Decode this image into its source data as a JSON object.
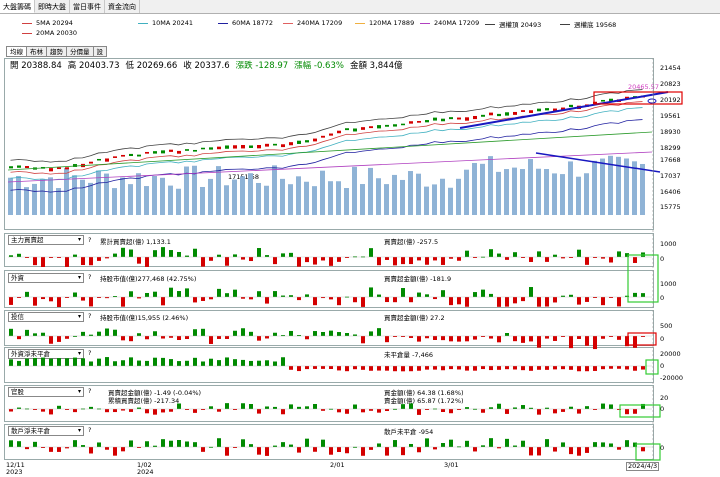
{
  "top_tabs": [
    "大盤籌碼",
    "即時大盤",
    "當日事件",
    "資金流向"
  ],
  "ma_legend": [
    {
      "label": "5MA 20294",
      "color": "#d04040"
    },
    {
      "label": "10MA 20241",
      "color": "#40b0c0"
    },
    {
      "label": "60MA 18772",
      "color": "#2020a0"
    },
    {
      "label": "240MA 17209",
      "color": "#e06060"
    },
    {
      "label": "120MA 17889",
      "color": "#f0b040"
    },
    {
      "label": "240MA 17209",
      "color": "#b040c0"
    },
    {
      "label": "週權頂 20493",
      "color": "#404040"
    },
    {
      "label": "週權底 19568",
      "color": "#404040"
    },
    {
      "label": "20MA 20030",
      "color": "#d04040"
    }
  ],
  "sub_tabs": [
    "均線",
    "布林",
    "趨勢",
    "分價量",
    "設"
  ],
  "quote": {
    "open": "開 20388.84",
    "high": "高 20403.73",
    "low": "低 20269.66",
    "close": "收 20337.6",
    "change": "漲跌 -128.97",
    "pct": "漲幅 -0.63%",
    "amount": "金額 3,844億"
  },
  "main_y_ticks": [
    "21454",
    "20823",
    "20192",
    "19561",
    "18930",
    "18299",
    "17668",
    "17037",
    "16406",
    "15775"
  ],
  "annotations": {
    "low_mark": "17151.58",
    "high_mark": "20465.57"
  },
  "panels": [
    {
      "select": "主力買賣超",
      "left": "累計買賣超(億) 1,133.1",
      "right": "買賣超(億) -257.5",
      "y": [
        "1000",
        "0"
      ]
    },
    {
      "select": "外資",
      "left": "持股市值(億)277,468 (42.75%)",
      "right": "買賣超金額(億) -181.9",
      "y": [
        "1000",
        "0"
      ]
    },
    {
      "select": "投信",
      "left": "持股市值(億)15,955 (2.46%)",
      "right": "買賣超金額(億) 27.2",
      "y": [
        "500",
        "0"
      ]
    },
    {
      "select": "外資淨未平倉",
      "left": "",
      "right": "未平倉量 -7,466",
      "y": [
        "20000",
        "0",
        "-20000"
      ]
    },
    {
      "select": "官股",
      "left": "買賣超金額(億) -1.49 (-0.04%)",
      "left2": "累積買賣超(億) -217.34",
      "right": "買金額(億) 64.38 (1.68%)",
      "right2": "賣金額(億) 65.87 (1.72%)",
      "y": [
        "20",
        "0"
      ]
    },
    {
      "select": "散戶淨未平倉",
      "left": "",
      "right": "散戶未平倉 -954",
      "y": [
        "0"
      ]
    }
  ],
  "x_labels": [
    {
      "top": "12/11",
      "bottom": "2023"
    },
    {
      "top": "1/02",
      "bottom": "2024"
    },
    {
      "top": "2/01",
      "bottom": ""
    },
    {
      "top": "3/01",
      "bottom": ""
    },
    {
      "top": "2024/4/3",
      "bottom": ""
    }
  ]
}
